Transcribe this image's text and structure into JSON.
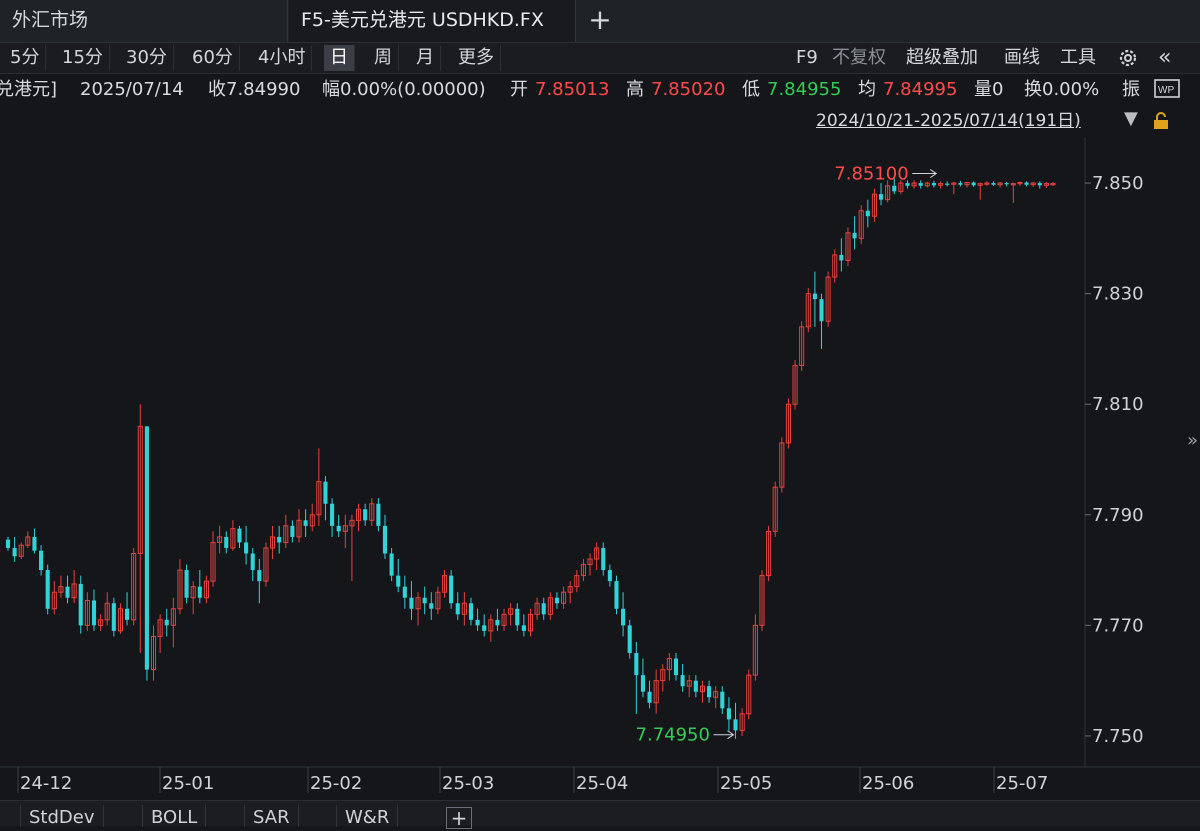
{
  "tabs": [
    {
      "label": "外汇市场"
    },
    {
      "label": "F5-美元兑港元 USDHKD.FX"
    }
  ],
  "tab_add_label": "+",
  "periods": [
    "5分",
    "15分",
    "30分",
    "60分",
    "4小时",
    "日",
    "周",
    "月",
    "更多"
  ],
  "active_period": "日",
  "toolbar_right": {
    "f9": "F9",
    "no_adjust": "不复权",
    "overlay": "超级叠加",
    "draw": "画线",
    "tools": "工具",
    "collapse": "«"
  },
  "info": {
    "name": "兑港元]",
    "date": "2025/07/14",
    "close": "收7.84990",
    "change_pct": "幅0.00%(0.00000)",
    "open_label": "开",
    "open": "7.85013",
    "high_label": "高",
    "high": "7.85020",
    "low_label": "低",
    "low": "7.84955",
    "avg_label": "均",
    "avg": "7.84995",
    "volume": "量0",
    "turnover": "换0.00%",
    "amplitude": "振"
  },
  "range": "2024/10/21-2025/07/14(191日)",
  "chart_data": {
    "type": "candlestick",
    "y_ticks": [
      "7.850",
      "7.830",
      "7.810",
      "7.790",
      "7.770",
      "7.750"
    ],
    "ylim": [
      7.748,
      7.852
    ],
    "x_labels": [
      "24-12",
      "25-01",
      "25-02",
      "25-03",
      "25-04",
      "25-05",
      "25-06",
      "25-07"
    ],
    "high_annotation": "7.85100",
    "low_annotation": "7.74950",
    "up_color": "#e8413e",
    "down_color": "#31d2d8",
    "ohlc": [
      [
        7.7855,
        7.786,
        7.7835,
        7.784
      ],
      [
        7.784,
        7.786,
        7.7815,
        7.7825
      ],
      [
        7.7825,
        7.785,
        7.782,
        7.7845
      ],
      [
        7.7845,
        7.787,
        7.784,
        7.786
      ],
      [
        7.786,
        7.7875,
        7.783,
        7.7835
      ],
      [
        7.7835,
        7.7845,
        7.779,
        7.78
      ],
      [
        7.78,
        7.781,
        7.772,
        7.773
      ],
      [
        7.773,
        7.778,
        7.772,
        7.776
      ],
      [
        7.776,
        7.779,
        7.775,
        7.777
      ],
      [
        7.777,
        7.779,
        7.774,
        7.775
      ],
      [
        7.775,
        7.78,
        7.774,
        7.7775
      ],
      [
        7.7775,
        7.779,
        7.7685,
        7.77
      ],
      [
        7.77,
        7.776,
        7.769,
        7.7745
      ],
      [
        7.7745,
        7.7765,
        7.769,
        7.77
      ],
      [
        7.77,
        7.772,
        7.769,
        7.771
      ],
      [
        7.771,
        7.776,
        7.77,
        7.774
      ],
      [
        7.774,
        7.775,
        7.768,
        7.769
      ],
      [
        7.769,
        7.774,
        7.7685,
        7.773
      ],
      [
        7.773,
        7.776,
        7.77,
        7.771
      ],
      [
        7.771,
        7.784,
        7.77,
        7.783
      ],
      [
        7.783,
        7.81,
        7.765,
        7.806
      ],
      [
        7.806,
        7.806,
        7.76,
        7.762
      ],
      [
        7.762,
        7.77,
        7.76,
        7.768
      ],
      [
        7.768,
        7.772,
        7.765,
        7.771
      ],
      [
        7.771,
        7.773,
        7.768,
        7.77
      ],
      [
        7.77,
        7.775,
        7.766,
        7.773
      ],
      [
        7.773,
        7.782,
        7.772,
        7.78
      ],
      [
        7.78,
        7.781,
        7.774,
        7.775
      ],
      [
        7.775,
        7.778,
        7.772,
        7.777
      ],
      [
        7.777,
        7.78,
        7.774,
        7.775
      ],
      [
        7.775,
        7.779,
        7.774,
        7.778
      ],
      [
        7.778,
        7.787,
        7.777,
        7.785
      ],
      [
        7.785,
        7.788,
        7.783,
        7.786
      ],
      [
        7.786,
        7.787,
        7.783,
        7.784
      ],
      [
        7.784,
        7.789,
        7.7835,
        7.7875
      ],
      [
        7.7875,
        7.788,
        7.784,
        7.785
      ],
      [
        7.785,
        7.788,
        7.781,
        7.783
      ],
      [
        7.783,
        7.784,
        7.778,
        7.78
      ],
      [
        7.78,
        7.782,
        7.774,
        7.778
      ],
      [
        7.778,
        7.785,
        7.777,
        7.784
      ],
      [
        7.784,
        7.788,
        7.782,
        7.786
      ],
      [
        7.786,
        7.788,
        7.783,
        7.785
      ],
      [
        7.785,
        7.79,
        7.784,
        7.788
      ],
      [
        7.788,
        7.789,
        7.785,
        7.786
      ],
      [
        7.786,
        7.791,
        7.785,
        7.789
      ],
      [
        7.789,
        7.791,
        7.786,
        7.788
      ],
      [
        7.788,
        7.792,
        7.787,
        7.79
      ],
      [
        7.79,
        7.802,
        7.788,
        7.796
      ],
      [
        7.796,
        7.797,
        7.789,
        7.792
      ],
      [
        7.792,
        7.793,
        7.786,
        7.788
      ],
      [
        7.788,
        7.79,
        7.786,
        7.787
      ],
      [
        7.787,
        7.79,
        7.784,
        7.788
      ],
      [
        7.788,
        7.79,
        7.778,
        7.789
      ],
      [
        7.789,
        7.792,
        7.787,
        7.791
      ],
      [
        7.791,
        7.792,
        7.788,
        7.789
      ],
      [
        7.789,
        7.793,
        7.788,
        7.792
      ],
      [
        7.792,
        7.793,
        7.787,
        7.788
      ],
      [
        7.788,
        7.79,
        7.782,
        7.783
      ],
      [
        7.783,
        7.784,
        7.778,
        7.779
      ],
      [
        7.779,
        7.782,
        7.776,
        7.777
      ],
      [
        7.777,
        7.779,
        7.773,
        7.775
      ],
      [
        7.775,
        7.778,
        7.771,
        7.773
      ],
      [
        7.773,
        7.776,
        7.77,
        7.775
      ],
      [
        7.775,
        7.777,
        7.772,
        7.774
      ],
      [
        7.774,
        7.776,
        7.771,
        7.773
      ],
      [
        7.773,
        7.777,
        7.772,
        7.776
      ],
      [
        7.776,
        7.78,
        7.775,
        7.779
      ],
      [
        7.779,
        7.78,
        7.773,
        7.774
      ],
      [
        7.774,
        7.776,
        7.771,
        7.772
      ],
      [
        7.772,
        7.776,
        7.77,
        7.774
      ],
      [
        7.774,
        7.775,
        7.77,
        7.771
      ],
      [
        7.771,
        7.773,
        7.769,
        7.77
      ],
      [
        7.77,
        7.772,
        7.768,
        7.769
      ],
      [
        7.769,
        7.772,
        7.767,
        7.771
      ],
      [
        7.771,
        7.773,
        7.769,
        7.77
      ],
      [
        7.77,
        7.773,
        7.769,
        7.772
      ],
      [
        7.772,
        7.774,
        7.77,
        7.773
      ],
      [
        7.773,
        7.774,
        7.769,
        7.77
      ],
      [
        7.77,
        7.772,
        7.768,
        7.769
      ],
      [
        7.769,
        7.773,
        7.768,
        7.772
      ],
      [
        7.772,
        7.775,
        7.771,
        7.774
      ],
      [
        7.774,
        7.775,
        7.771,
        7.772
      ],
      [
        7.772,
        7.776,
        7.771,
        7.775
      ],
      [
        7.775,
        7.776,
        7.773,
        7.774
      ],
      [
        7.774,
        7.777,
        7.773,
        7.776
      ],
      [
        7.776,
        7.778,
        7.774,
        7.777
      ],
      [
        7.777,
        7.78,
        7.776,
        7.779
      ],
      [
        7.779,
        7.782,
        7.778,
        7.781
      ],
      [
        7.781,
        7.783,
        7.779,
        7.782
      ],
      [
        7.782,
        7.785,
        7.78,
        7.784
      ],
      [
        7.784,
        7.785,
        7.779,
        7.78
      ],
      [
        7.78,
        7.781,
        7.777,
        7.778
      ],
      [
        7.778,
        7.779,
        7.772,
        7.773
      ],
      [
        7.773,
        7.776,
        7.768,
        7.77
      ],
      [
        7.77,
        7.771,
        7.764,
        7.765
      ],
      [
        7.765,
        7.767,
        7.754,
        7.761
      ],
      [
        7.761,
        7.764,
        7.757,
        7.758
      ],
      [
        7.758,
        7.76,
        7.755,
        7.756
      ],
      [
        7.756,
        7.762,
        7.754,
        7.76
      ],
      [
        7.76,
        7.763,
        7.758,
        7.762
      ],
      [
        7.762,
        7.765,
        7.76,
        7.764
      ],
      [
        7.764,
        7.765,
        7.76,
        7.761
      ],
      [
        7.761,
        7.763,
        7.758,
        7.759
      ],
      [
        7.759,
        7.761,
        7.757,
        7.76
      ],
      [
        7.76,
        7.761,
        7.757,
        7.758
      ],
      [
        7.758,
        7.76,
        7.756,
        7.759
      ],
      [
        7.759,
        7.76,
        7.756,
        7.757
      ],
      [
        7.757,
        7.759,
        7.755,
        7.758
      ],
      [
        7.758,
        7.759,
        7.754,
        7.755
      ],
      [
        7.755,
        7.757,
        7.751,
        7.753
      ],
      [
        7.753,
        7.756,
        7.7495,
        7.751
      ],
      [
        7.751,
        7.755,
        7.75,
        7.754
      ],
      [
        7.754,
        7.762,
        7.753,
        7.761
      ],
      [
        7.761,
        7.772,
        7.76,
        7.77
      ],
      [
        7.77,
        7.78,
        7.769,
        7.779
      ],
      [
        7.779,
        7.788,
        7.778,
        7.787
      ],
      [
        7.787,
        7.796,
        7.786,
        7.795
      ],
      [
        7.795,
        7.804,
        7.794,
        7.803
      ],
      [
        7.803,
        7.811,
        7.802,
        7.81
      ],
      [
        7.81,
        7.818,
        7.809,
        7.817
      ],
      [
        7.817,
        7.825,
        7.816,
        7.824
      ],
      [
        7.824,
        7.831,
        7.823,
        7.83
      ],
      [
        7.83,
        7.834,
        7.824,
        7.829
      ],
      [
        7.829,
        7.83,
        7.82,
        7.825
      ],
      [
        7.825,
        7.834,
        7.824,
        7.833
      ],
      [
        7.833,
        7.838,
        7.832,
        7.837
      ],
      [
        7.837,
        7.84,
        7.834,
        7.836
      ],
      [
        7.836,
        7.842,
        7.835,
        7.841
      ],
      [
        7.841,
        7.844,
        7.838,
        7.84
      ],
      [
        7.84,
        7.846,
        7.839,
        7.845
      ],
      [
        7.845,
        7.847,
        7.842,
        7.844
      ],
      [
        7.844,
        7.849,
        7.843,
        7.848
      ],
      [
        7.848,
        7.85,
        7.846,
        7.847
      ],
      [
        7.847,
        7.8505,
        7.8465,
        7.8495
      ],
      [
        7.8495,
        7.851,
        7.848,
        7.8485
      ],
      [
        7.8485,
        7.8505,
        7.848,
        7.85
      ],
      [
        7.85,
        7.8505,
        7.849,
        7.8495
      ],
      [
        7.8495,
        7.8505,
        7.849,
        7.85
      ],
      [
        7.85,
        7.8505,
        7.849,
        7.8495
      ],
      [
        7.8495,
        7.8502,
        7.8492,
        7.85
      ],
      [
        7.85,
        7.8504,
        7.8492,
        7.8496
      ],
      [
        7.8496,
        7.8503,
        7.849,
        7.8499
      ],
      [
        7.8499,
        7.8503,
        7.8494,
        7.8498
      ],
      [
        7.8498,
        7.8502,
        7.848,
        7.85
      ],
      [
        7.85,
        7.8504,
        7.8494,
        7.8497
      ],
      [
        7.8497,
        7.8502,
        7.8492,
        7.8501
      ],
      [
        7.8501,
        7.8503,
        7.8493,
        7.8496
      ],
      [
        7.8496,
        7.8501,
        7.847,
        7.8499
      ],
      [
        7.8499,
        7.8503,
        7.8495,
        7.85
      ],
      [
        7.85,
        7.8503,
        7.8495,
        7.8497
      ],
      [
        7.8497,
        7.8502,
        7.8492,
        7.85
      ],
      [
        7.85,
        7.8502,
        7.8494,
        7.8498
      ],
      [
        7.8498,
        7.8501,
        7.8464,
        7.8499
      ],
      [
        7.8499,
        7.8503,
        7.8495,
        7.8501
      ],
      [
        7.8501,
        7.8503,
        7.8494,
        7.8497
      ],
      [
        7.8497,
        7.8502,
        7.8493,
        7.85
      ],
      [
        7.85,
        7.8503,
        7.849,
        7.8496
      ],
      [
        7.8496,
        7.8502,
        7.8491,
        7.8499
      ],
      [
        7.8499,
        7.8502,
        7.8495,
        7.8499
      ]
    ]
  },
  "bottom_tabs": [
    "StdDev",
    "BOLL",
    "SAR",
    "W&R"
  ],
  "bottom_add_label": "+",
  "colors": {
    "background": "#141619",
    "up": "#e8413e",
    "down": "#31d2d8",
    "price_red": "#ff4b4b",
    "price_green": "#33cc55"
  }
}
